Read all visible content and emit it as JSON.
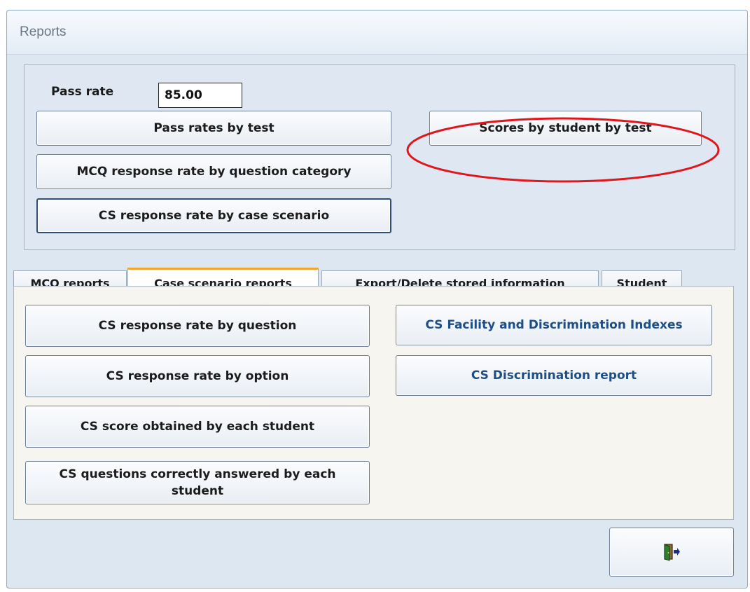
{
  "window": {
    "title": "Reports"
  },
  "top": {
    "pass_rate_label": "Pass rate",
    "pass_rate_value": "85.00",
    "buttons": {
      "pass_rates_by_test": "Pass rates by test",
      "mcq_response_rate": "MCQ response rate by question category",
      "cs_response_rate_case": "CS response rate by case scenario",
      "scores_by_student": "Scores by student by test"
    },
    "highlight_color": "#e0161c"
  },
  "tabs": [
    {
      "label": "MCQ reports"
    },
    {
      "label": "Case scenario reports"
    },
    {
      "label": "Export/Delete stored information"
    },
    {
      "label": "Student"
    }
  ],
  "case_tab": {
    "left_buttons": [
      "CS  response rate by question",
      "CS response  rate by option",
      "CS score obtained by each student",
      "CS questions correctly answered by each student"
    ],
    "right_buttons": [
      "CS Facility and Discrimination Indexes",
      "CS Discrimination report"
    ]
  },
  "footer": {
    "exit_icon": "exit-door-icon"
  }
}
